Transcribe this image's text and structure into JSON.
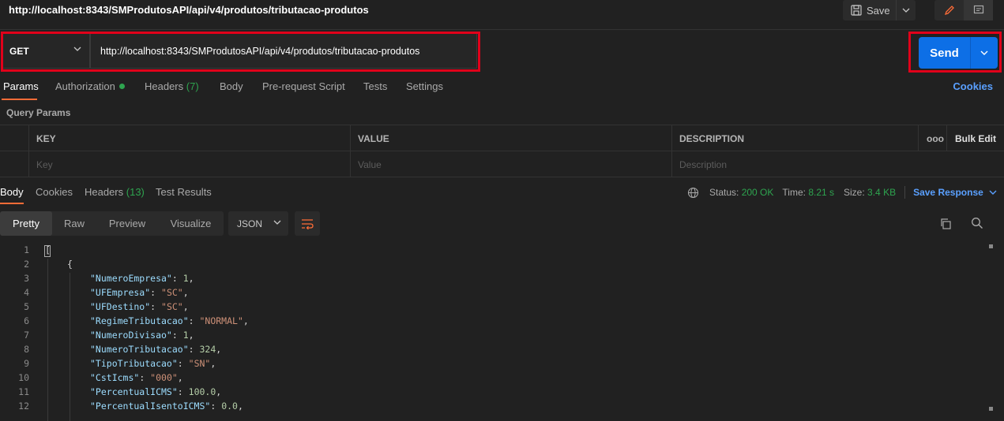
{
  "request": {
    "tab_title": "http://localhost:8343/SMProdutosAPI/api/v4/produtos/tributacao-produtos",
    "method": "GET",
    "url": "http://localhost:8343/SMProdutosAPI/api/v4/produtos/tributacao-produtos",
    "send_label": "Send",
    "save_label": "Save"
  },
  "request_tabs": {
    "params": "Params",
    "authorization": "Authorization",
    "headers": "Headers",
    "headers_count": "(7)",
    "body": "Body",
    "pre_request": "Pre-request Script",
    "tests": "Tests",
    "settings": "Settings",
    "cookies": "Cookies"
  },
  "query_params": {
    "label": "Query Params",
    "columns": {
      "key": "KEY",
      "value": "VALUE",
      "description": "DESCRIPTION",
      "more": "ooo",
      "bulk_edit": "Bulk Edit"
    },
    "placeholders": {
      "key": "Key",
      "value": "Value",
      "description": "Description"
    }
  },
  "response_tabs": {
    "body": "Body",
    "cookies": "Cookies",
    "headers": "Headers",
    "headers_count": "(13)",
    "test_results": "Test Results"
  },
  "response_status": {
    "status_label": "Status:",
    "status_value": "200 OK",
    "time_label": "Time:",
    "time_value": "8.21 s",
    "size_label": "Size:",
    "size_value": "3.4 KB",
    "save_response": "Save Response"
  },
  "view_modes": {
    "pretty": "Pretty",
    "raw": "Raw",
    "preview": "Preview",
    "visualize": "Visualize",
    "format": "JSON"
  },
  "code_lines": [
    {
      "num": "1",
      "text": "["
    },
    {
      "num": "2",
      "text": "{"
    },
    {
      "num": "3",
      "key": "\"NumeroEmpresa\"",
      "num_val": "1",
      "trail": ","
    },
    {
      "num": "4",
      "key": "\"UFEmpresa\"",
      "str_val": "\"SC\"",
      "trail": ","
    },
    {
      "num": "5",
      "key": "\"UFDestino\"",
      "str_val": "\"SC\"",
      "trail": ","
    },
    {
      "num": "6",
      "key": "\"RegimeTributacao\"",
      "str_val": "\"NORMAL\"",
      "trail": ","
    },
    {
      "num": "7",
      "key": "\"NumeroDivisao\"",
      "num_val": "1",
      "trail": ","
    },
    {
      "num": "8",
      "key": "\"NumeroTributacao\"",
      "num_val": "324",
      "trail": ","
    },
    {
      "num": "9",
      "key": "\"TipoTributacao\"",
      "str_val": "\"SN\"",
      "trail": ","
    },
    {
      "num": "10",
      "key": "\"CstIcms\"",
      "str_val": "\"000\"",
      "trail": ","
    },
    {
      "num": "11",
      "key": "\"PercentualICMS\"",
      "num_val": "100.0",
      "trail": ","
    },
    {
      "num": "12",
      "key": "\"PercentualIsentoICMS\"",
      "num_val": "0.0",
      "trail": ","
    }
  ],
  "colors": {
    "accent_orange": "#ff6c37",
    "send_blue": "#0d6fe6",
    "status_green": "#2ea44f",
    "highlight_red": "#e1001a",
    "link_blue": "#5aa0ff"
  }
}
